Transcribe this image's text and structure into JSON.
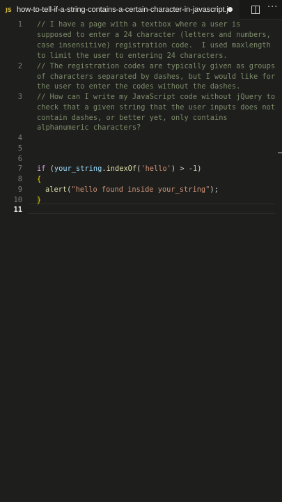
{
  "tab": {
    "badge": "JS",
    "title": "how-to-tell-if-a-string-contains-a-certain-character-in-javascript.js"
  },
  "icons": {
    "split": "split-editor-icon",
    "more": "more-actions-icon"
  },
  "line_numbers": [
    "1",
    "2",
    "3",
    "4",
    "5",
    "6",
    "7",
    "8",
    "9",
    "10",
    "11"
  ],
  "code": {
    "l1a": "// I have a page with a textbox where a user is",
    "l1b": "supposed to enter a 24 character (letters and numbers,",
    "l1c": "case insensitive) registration code.  I used maxlength",
    "l1d": "to limit the user to entering 24 characters.",
    "l2a": "// The registration codes are typically given as groups",
    "l2b": "of characters separated by dashes, but I would like for",
    "l2c": "the user to enter the codes without the dashes.",
    "l3a": "// How can I write my JavaScript code without jQuery to",
    "l3b": "check that a given string that the user inputs does not",
    "l3c": "contain dashes, or better yet, only contains",
    "l3d": "alphanumeric characters?",
    "l7_kw": "if",
    "l7_p1": " (",
    "l7_var": "your_string",
    "l7_p2": ".",
    "l7_fn": "indexOf",
    "l7_p3": "(",
    "l7_str": "'hello'",
    "l7_p4": ") > ",
    "l7_num": "-1",
    "l7_p5": ")",
    "l8": "{",
    "l9_fn": "alert",
    "l9_p1": "(",
    "l9_str": "\"hello found inside your_string\"",
    "l9_p2": ");",
    "l10": "}"
  },
  "colors": {
    "background": "#1e1f1c",
    "comment": "#7c8a6a",
    "keyword": "#d8a0df",
    "string": "#ce9178",
    "function": "#dcdcaa",
    "variable": "#9cdcfe",
    "js_badge": "#d7ba3c"
  }
}
